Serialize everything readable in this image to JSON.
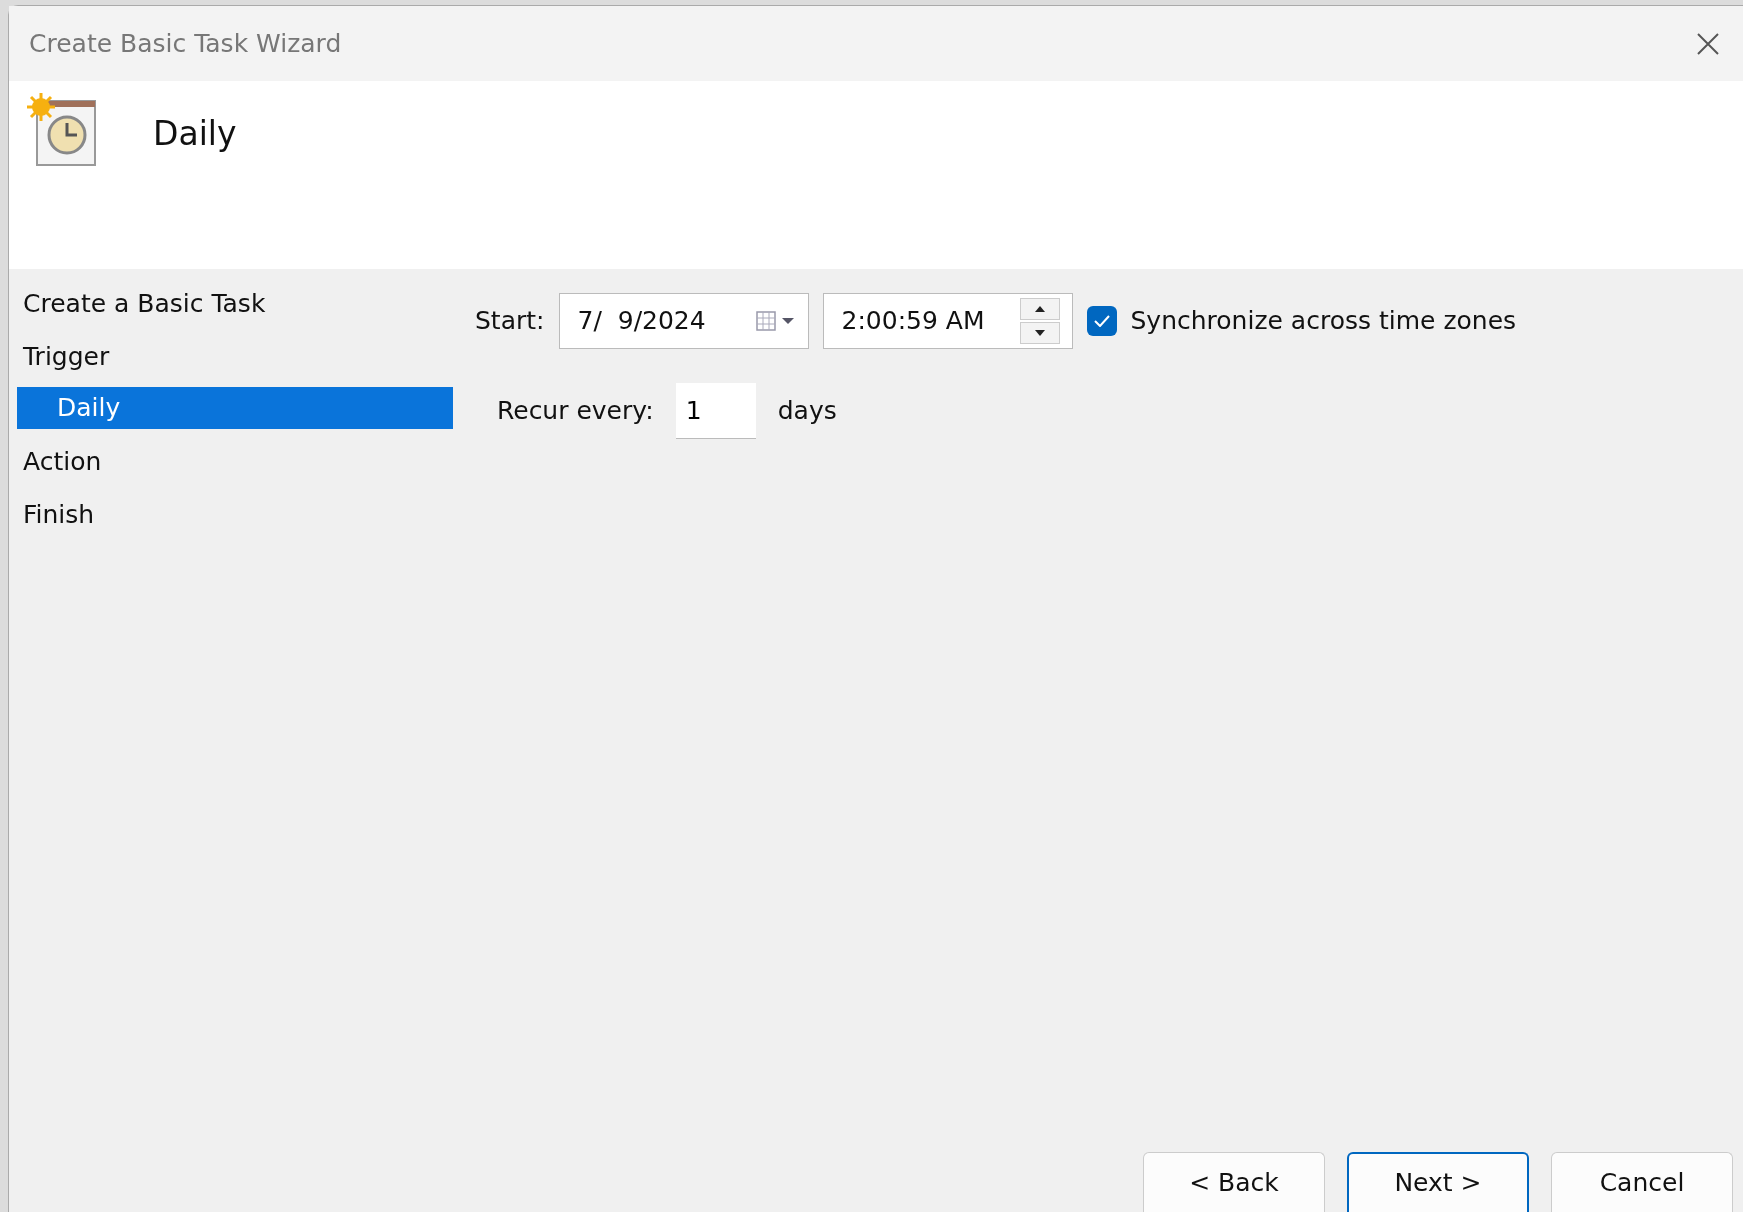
{
  "window": {
    "title": "Create Basic Task Wizard"
  },
  "header": {
    "title": "Daily"
  },
  "steps": [
    {
      "label": "Create a Basic Task",
      "selected": false
    },
    {
      "label": "Trigger",
      "selected": false,
      "children": [
        {
          "label": "Daily",
          "selected": true
        }
      ]
    },
    {
      "label": "Action",
      "selected": false
    },
    {
      "label": "Finish",
      "selected": false
    }
  ],
  "start": {
    "label": "Start:",
    "date": "7/  9/2024",
    "time": "2:00:59 AM"
  },
  "sync": {
    "label": "Synchronize across time zones",
    "checked": true
  },
  "recur": {
    "label": "Recur every:",
    "value": "1",
    "unit": "days"
  },
  "buttons": [
    {
      "label": "< Back",
      "default": false
    },
    {
      "label": "Next >",
      "default": true
    },
    {
      "label": "Cancel",
      "default": false
    }
  ]
}
